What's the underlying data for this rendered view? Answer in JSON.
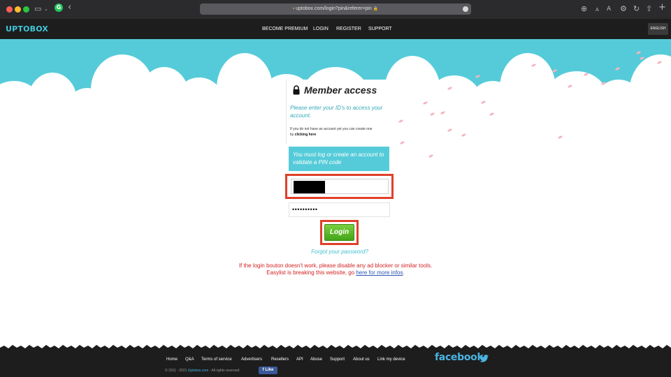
{
  "browser": {
    "url": "uptobox.com/login?pin&referer=pin",
    "lock_glyph": "🔒",
    "font_small": "A",
    "font_large": "A"
  },
  "header": {
    "logo": "UPTOBOX",
    "nav": [
      "BECOME PREMIUM",
      "LOGIN",
      "REGISTER",
      "SUPPORT"
    ],
    "language": "ENGLISH"
  },
  "login": {
    "title": "Member access",
    "subtitle": "Please enter your ID's to access your account.",
    "note_prefix": "If you do not have an account yet you can create one by ",
    "note_link": "clicking here",
    "pin_message": "You must log or create an account to validate a PIN code",
    "password_value": "••••••••••",
    "button": "Login",
    "forgot": "Forgot your password?"
  },
  "warning": {
    "line1": "If the login bouton doesn't work, please disable any ad blocker or similar tools.",
    "line2_prefix": "Easylist is breaking this website, go ",
    "line2_link": "here for more infos",
    "line2_suffix": "."
  },
  "footer": {
    "links": [
      "Home",
      "Q&A",
      "Terms of service",
      "Advertisers",
      "Resellers",
      "API",
      "Abuse",
      "Support",
      "About us",
      "Link my device"
    ],
    "facebook": "facebook",
    "copyright_prefix": "© 2011 - 2021 ",
    "copyright_site": "Uptobox.com",
    "copyright_suffix": " - All rights reserved",
    "like": "f  Like"
  },
  "colors": {
    "accent": "#55cbd9",
    "highlight": "#e0402a",
    "button_green": "#43a418",
    "warning_red": "#d32222"
  }
}
